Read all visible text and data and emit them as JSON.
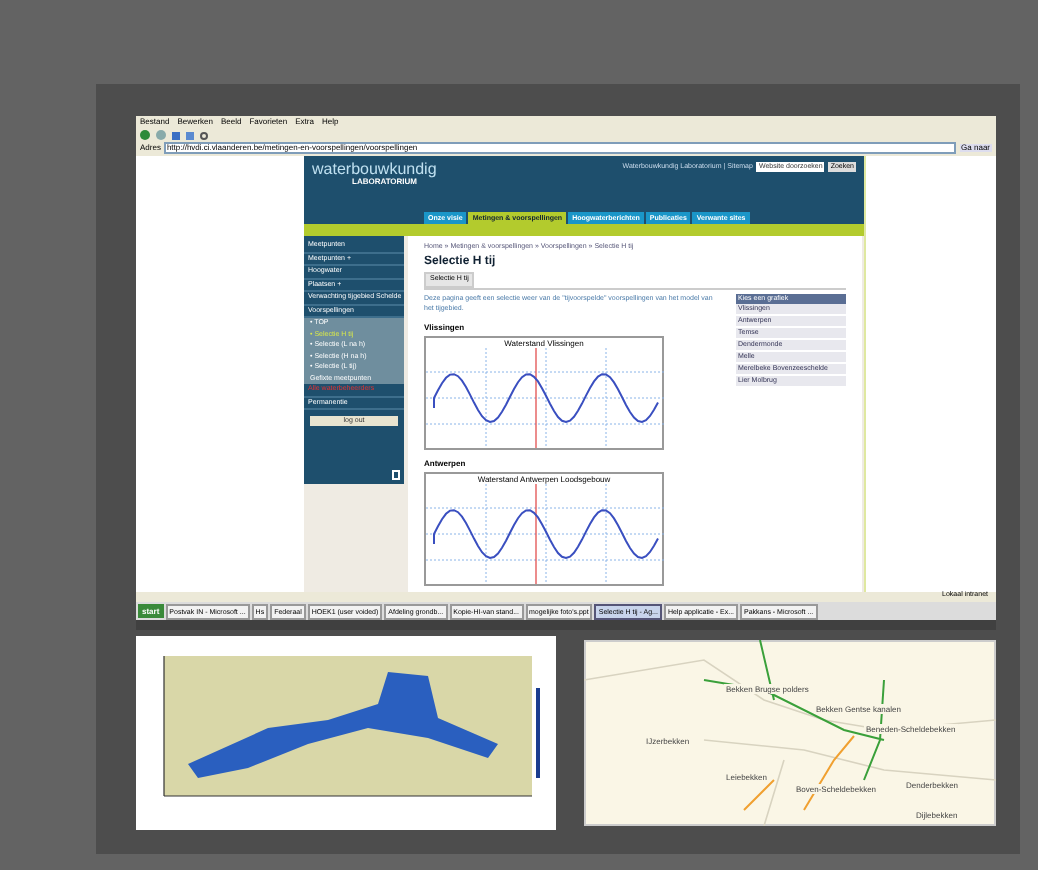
{
  "browser": {
    "menu": [
      "Bestand",
      "Bewerken",
      "Beeld",
      "Favorieten",
      "Extra",
      "Help"
    ],
    "address_label": "Adres",
    "address": "http://hvdi.ci.vlaanderen.be/metingen-en-voorspellingen/voorspellingen",
    "go": "Ga naar"
  },
  "site": {
    "logo": "waterbouwkundig",
    "logo_sub": "LABORATORIUM",
    "top_links": "Waterbouwkundig Laboratorium | Sitemap",
    "search_placeholder": "Website doorzoeken",
    "search_button": "Zoeken",
    "nav": [
      {
        "label": "Onze visie",
        "selected": false
      },
      {
        "label": "Metingen & voorspellingen",
        "selected": true
      },
      {
        "label": "Hoogwaterberichten",
        "selected": false
      },
      {
        "label": "Publicaties",
        "selected": false
      },
      {
        "label": "Verwante sites",
        "selected": false
      }
    ],
    "sidebar": [
      {
        "label": "Meetpunten",
        "kind": "item",
        "selected": false
      },
      {
        "label": "Meetpunten +",
        "kind": "item",
        "selected": false
      },
      {
        "label": "Hoogwater",
        "kind": "item",
        "selected": false
      },
      {
        "label": "Plaatsen +",
        "kind": "item",
        "selected": false
      },
      {
        "label": "Verwachting tijgebied Schelde",
        "kind": "item",
        "selected": false
      },
      {
        "label": "Voorspellingen",
        "kind": "item",
        "selected": false
      },
      {
        "label": "• TOP",
        "kind": "sub",
        "selected": false
      },
      {
        "label": "• Selectie H tij",
        "kind": "sub",
        "selected": true
      },
      {
        "label": "• Selectie (L na h)",
        "kind": "sub",
        "selected": false
      },
      {
        "label": "• Selectie (H na h)",
        "kind": "sub",
        "selected": false
      },
      {
        "label": "• Selectie (L tij)",
        "kind": "sub",
        "selected": false
      },
      {
        "label": "Gefixte meetpunten",
        "kind": "sub",
        "selected": false
      },
      {
        "label": "Alle waterbeheerders",
        "kind": "alert",
        "selected": false
      },
      {
        "label": "Permanentie",
        "kind": "item",
        "selected": false
      },
      {
        "label": "log out",
        "kind": "button",
        "selected": false
      }
    ],
    "breadcrumb": "Home » Metingen & voorspellingen » Voorspellingen » Selectie H tij",
    "title": "Selectie H tij",
    "tab": "Selectie H tij",
    "intro": "Deze pagina geeft een selectie weer van de \"tijvoorspelde\" voorspellingen van het model van het tijgebied.",
    "charts": [
      {
        "heading": "Vlissingen",
        "title": "Waterstand Vlissingen"
      },
      {
        "heading": "Antwerpen",
        "title": "Waterstand Antwerpen Loodsgebouw"
      }
    ],
    "chart_menu": {
      "title": "Kies een grafiek",
      "items": [
        "Vlissingen",
        "Antwerpen",
        "Temse",
        "Dendermonde",
        "Melle",
        "Merelbeke Bovenzeeschelde",
        "Lier Molbrug"
      ]
    }
  },
  "taskbar": {
    "start": "start",
    "status": "Lokaal intranet",
    "tasks": [
      {
        "label": "Postvak IN - Microsoft ...",
        "selected": false
      },
      {
        "label": "Hs",
        "selected": false
      },
      {
        "label": "Federaal",
        "selected": false
      },
      {
        "label": "HOEK1 (user voided)",
        "selected": false
      },
      {
        "label": "Afdeling grondb...",
        "selected": false
      },
      {
        "label": "Kopie-HI-van stand...",
        "selected": false
      },
      {
        "label": "mogelijke foto's.ppt",
        "selected": false
      },
      {
        "label": "Selectie H tij - Ag...",
        "selected": true
      },
      {
        "label": "Help applicatie - Ex...",
        "selected": false
      },
      {
        "label": "Pakkans - Microsoft ...",
        "selected": false
      }
    ]
  },
  "map": {
    "labels": [
      "Bekken Brugse polders",
      "Bekken Gentse kanalen",
      "IJzerbekken",
      "Beneden-Scheldebekken",
      "Leiebekken",
      "Boven-Scheldebekken",
      "Denderbekken",
      "Dijlebekken"
    ]
  }
}
